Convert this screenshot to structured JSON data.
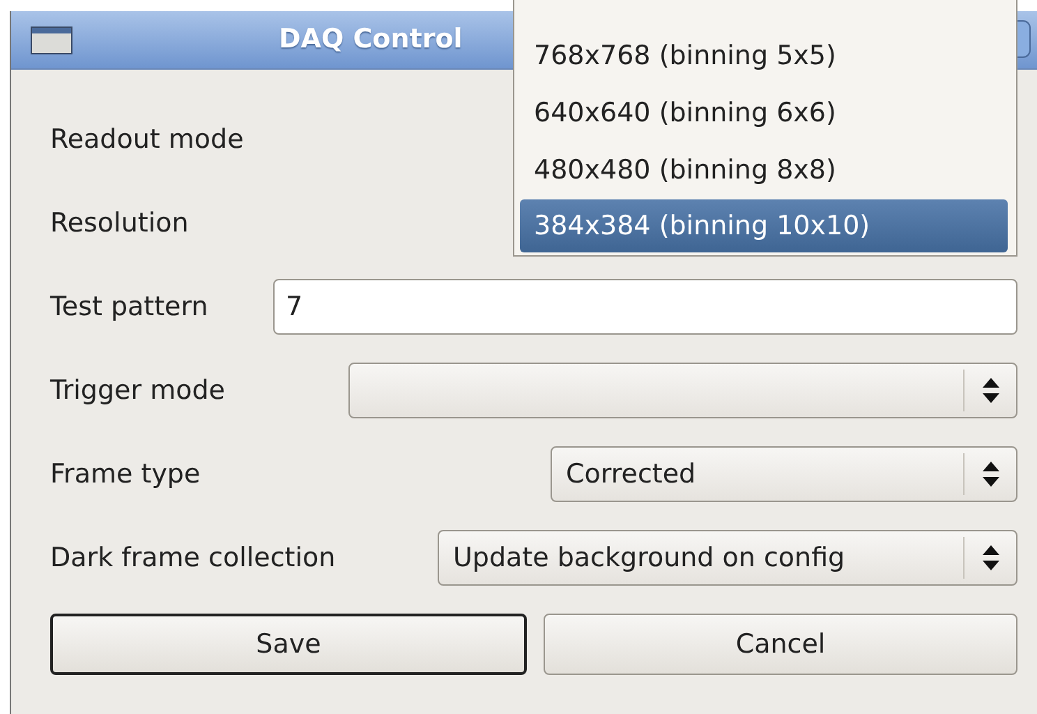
{
  "window": {
    "title": "DAQ Control"
  },
  "form": {
    "rows": [
      {
        "label": "Readout mode",
        "kind": "covered"
      },
      {
        "label": "Resolution",
        "kind": "covered"
      },
      {
        "label": "Test pattern",
        "kind": "text",
        "value": "7"
      },
      {
        "label": "Trigger mode",
        "kind": "combo",
        "value": ""
      },
      {
        "label": "Frame type",
        "kind": "combo",
        "value": "Corrected"
      },
      {
        "label": "Dark frame collection",
        "kind": "combo",
        "value": "Update background on config"
      }
    ]
  },
  "buttons": [
    {
      "label": "Save",
      "default": true
    },
    {
      "label": "Cancel",
      "default": false
    }
  ],
  "dropdown": {
    "items": [
      {
        "label": "768x768 (binning 5x5)",
        "selected": false
      },
      {
        "label": "640x640 (binning 6x6)",
        "selected": false
      },
      {
        "label": "480x480 (binning 8x8)",
        "selected": false
      },
      {
        "label": "384x384 (binning 10x10)",
        "selected": true
      }
    ]
  }
}
